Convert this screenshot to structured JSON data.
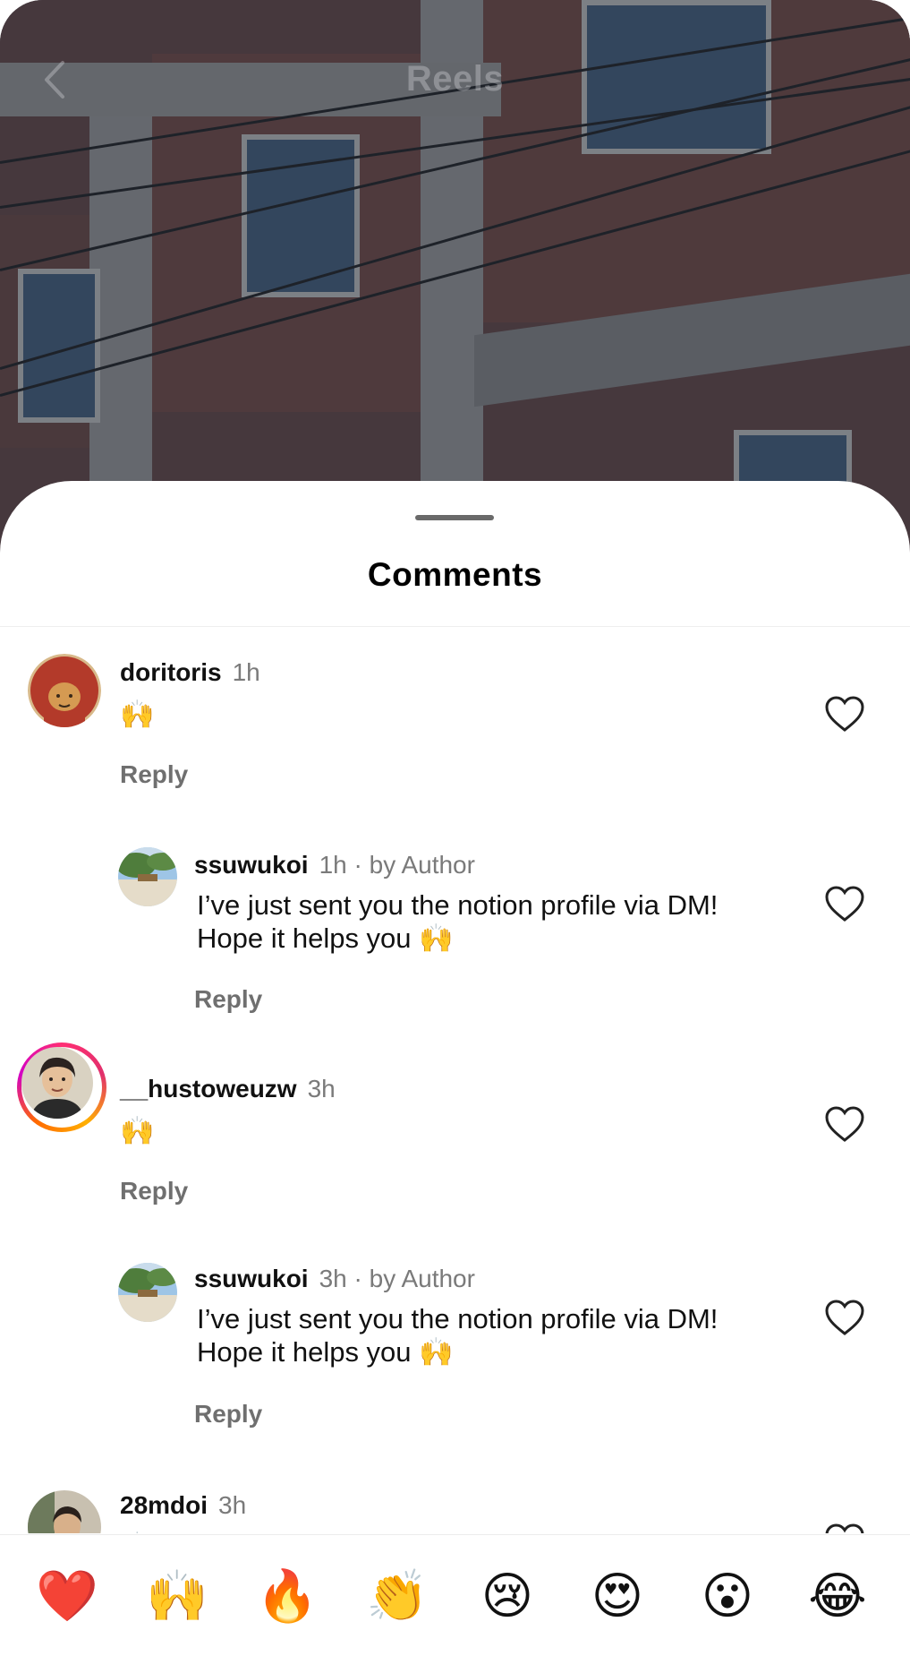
{
  "header": {
    "title": "Reels"
  },
  "sheet": {
    "title": "Comments"
  },
  "comments": [
    {
      "user": "doritoris",
      "time": "1h",
      "text": "🙌",
      "reply": "Reply"
    },
    {
      "user": "ssuwukoi",
      "time": "1h",
      "by": "· by Author",
      "text": "I’ve just sent you the notion profile via DM! Hope it helps you 🙌",
      "reply": "Reply"
    },
    {
      "user": "__hustoweuzw",
      "time": "3h",
      "text": "🙌",
      "reply": "Reply"
    },
    {
      "user": "ssuwukoi",
      "time": "3h",
      "by": "· by Author",
      "text": "I’ve just sent you the notion profile via DM! Hope it helps you 🙌",
      "reply": "Reply"
    },
    {
      "user": "28mdoi",
      "time": "3h",
      "text": "🙌"
    }
  ],
  "reactions": [
    "❤️",
    "🙌",
    "🔥",
    "👏",
    "😢",
    "😍",
    "😮",
    "😂"
  ],
  "colors": {
    "accent_text": "#111111",
    "muted": "#7a7a7a",
    "sheet_bg": "#ffffff"
  }
}
